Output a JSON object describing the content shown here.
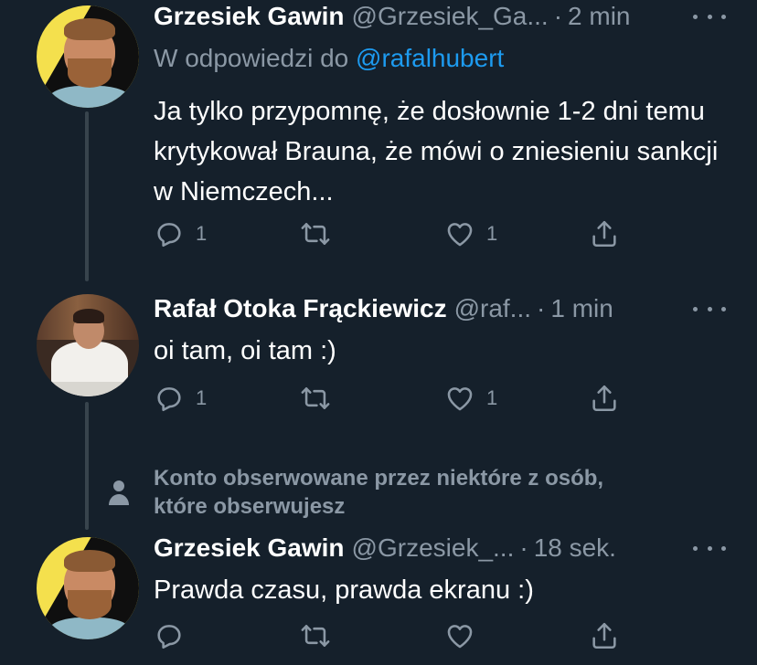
{
  "tweets": [
    {
      "name": "Grzesiek Gawin",
      "handle": "@Grzesiek_Ga...",
      "time": "2 min",
      "reply_prefix": "W odpowiedzi do ",
      "reply_mention": "@rafalhubert",
      "text": "Ja tylko przypomnę, że dosłownie 1-2 dni temu krytykował Brauna, że mówi o zniesieniu sankcji w Niemczech...",
      "reply_count": "1",
      "like_count": "1"
    },
    {
      "name": "Rafał Otoka Frąckiewicz",
      "handle": "@raf...",
      "time": "1 min",
      "text": "oi tam, oi tam :)",
      "reply_count": "1",
      "like_count": "1"
    },
    {
      "social_context": "Konto obserwowane przez niektóre z osób, które obserwujesz",
      "name": "Grzesiek Gawin",
      "handle": "@Grzesiek_...",
      "time": "18 sek.",
      "text": "Prawda czasu, prawda ekranu :)"
    }
  ],
  "separator": "·",
  "colors": {
    "background": "#15202b",
    "secondary_text": "#8b98a5",
    "link": "#1d9bf0",
    "thread_line": "#38444d"
  },
  "icons": [
    "reply-icon",
    "retweet-icon",
    "like-icon",
    "share-icon",
    "more-icon",
    "person-icon"
  ]
}
